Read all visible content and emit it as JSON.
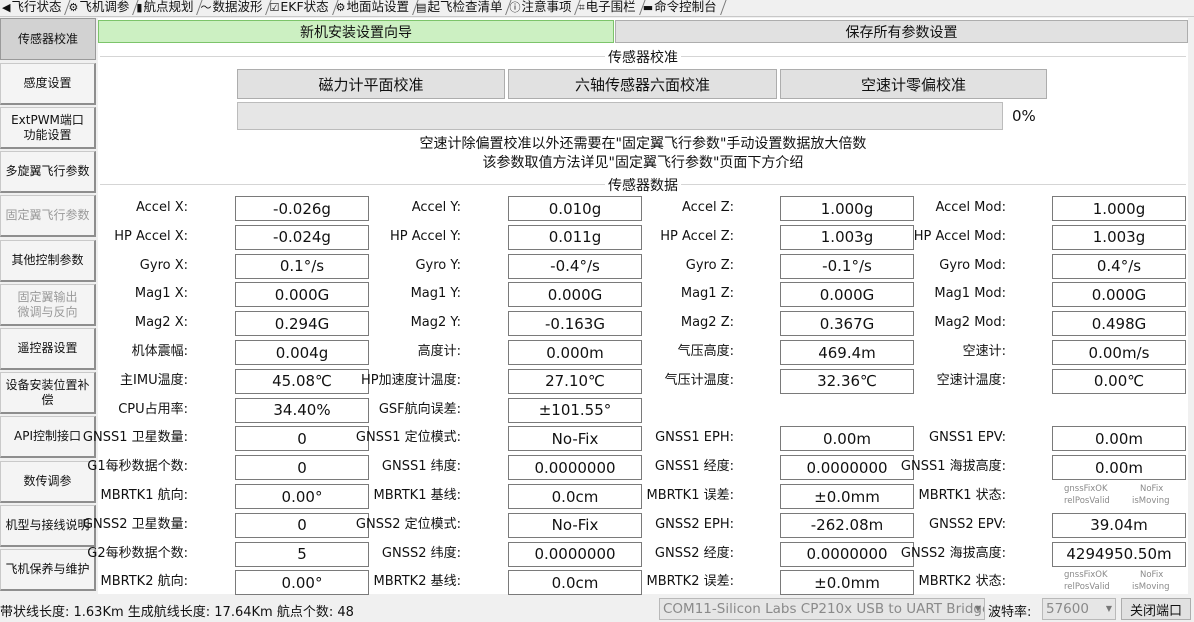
{
  "tabs": [
    {
      "icon": "◀",
      "icon_name": "arrow-icon",
      "label": "飞行状态"
    },
    {
      "icon": "⚙",
      "icon_name": "gear-icon",
      "label": "飞机调参"
    },
    {
      "icon": "▮",
      "icon_name": "book-icon",
      "label": "航点规划"
    },
    {
      "icon": "〜",
      "icon_name": "wave-chart-icon",
      "label": "数据波形"
    },
    {
      "icon": "☑",
      "icon_name": "checklist-icon",
      "label": "EKF状态"
    },
    {
      "icon": "⚙",
      "icon_name": "gear-icon",
      "label": "地面站设置"
    },
    {
      "icon": "▤",
      "icon_name": "list-icon",
      "label": "起飞检查清单"
    },
    {
      "icon": "ⓘ",
      "icon_name": "info-icon",
      "label": "注意事项"
    },
    {
      "icon": "⌗",
      "icon_name": "fence-icon",
      "label": "电子围栏"
    },
    {
      "icon": "▬",
      "icon_name": "terminal-icon",
      "label": "命令控制台"
    }
  ],
  "sidebar": [
    {
      "label": "传感器校准",
      "active": true
    },
    {
      "label": "感度设置"
    },
    {
      "label": "ExtPWM端口\n功能设置"
    },
    {
      "label": "多旋翼飞行参数"
    },
    {
      "label": "固定翼飞行参数",
      "disabled": true
    },
    {
      "label": "其他控制参数"
    },
    {
      "label": "固定翼输出\n微调与反向",
      "disabled": true
    },
    {
      "label": "遥控器设置"
    },
    {
      "label": "设备安装位置补偿"
    },
    {
      "label": "API控制接口"
    },
    {
      "label": "数传调参"
    },
    {
      "label": "机型与接线说明"
    },
    {
      "label": "飞机保养与维护"
    }
  ],
  "top_buttons": {
    "wizard": "新机安装设置向导",
    "save_all": "保存所有参数设置"
  },
  "calibration": {
    "title": "传感器校准",
    "buttons": [
      "磁力计平面校准",
      "六轴传感器六面校准",
      "空速计零偏校准"
    ],
    "progress_value": 0,
    "progress_text": "0%",
    "note_line1": "空速计除偏置校准以外还需要在\"固定翼飞行参数\"手动设置数据放大倍数",
    "note_line2": "该参数取值方法详见\"固定翼飞行参数\"页面下方介绍"
  },
  "sensor_title": "传感器数据",
  "sensor_rows": [
    [
      [
        "Accel X:",
        "-0.026g"
      ],
      [
        "Accel Y:",
        "0.010g"
      ],
      [
        "Accel Z:",
        "1.000g"
      ],
      [
        "Accel Mod:",
        "1.000g"
      ]
    ],
    [
      [
        "HP Accel X:",
        "-0.024g"
      ],
      [
        "HP Accel Y:",
        "0.011g"
      ],
      [
        "HP Accel Z:",
        "1.003g"
      ],
      [
        "HP Accel Mod:",
        "1.003g"
      ]
    ],
    [
      [
        "Gyro X:",
        "0.1°/s"
      ],
      [
        "Gyro Y:",
        "-0.4°/s"
      ],
      [
        "Gyro Z:",
        "-0.1°/s"
      ],
      [
        "Gyro Mod:",
        "0.4°/s"
      ]
    ],
    [
      [
        "Mag1 X:",
        "0.000G"
      ],
      [
        "Mag1 Y:",
        "0.000G"
      ],
      [
        "Mag1 Z:",
        "0.000G"
      ],
      [
        "Mag1 Mod:",
        "0.000G"
      ]
    ],
    [
      [
        "Mag2 X:",
        "0.294G"
      ],
      [
        "Mag2 Y:",
        "-0.163G"
      ],
      [
        "Mag2 Z:",
        "0.367G"
      ],
      [
        "Mag2 Mod:",
        "0.498G"
      ]
    ],
    [
      [
        "机体震幅:",
        "0.004g"
      ],
      [
        "高度计:",
        "0.000m"
      ],
      [
        "气压高度:",
        "469.4m"
      ],
      [
        "空速计:",
        "0.00m/s"
      ]
    ],
    [
      [
        "主IMU温度:",
        "45.08℃"
      ],
      [
        "HP加速度计温度:",
        "27.10℃"
      ],
      [
        "气压计温度:",
        "32.36℃"
      ],
      [
        "空速计温度:",
        "0.00℃"
      ]
    ],
    [
      [
        "CPU占用率:",
        "34.40%"
      ],
      [
        "GSF航向误差:",
        "±101.55°"
      ],
      null,
      null
    ],
    [
      [
        "GNSS1 卫星数量:",
        "0"
      ],
      [
        "GNSS1 定位模式:",
        "No-Fix"
      ],
      [
        "GNSS1 EPH:",
        "0.00m"
      ],
      [
        "GNSS1 EPV:",
        "0.00m"
      ]
    ],
    [
      [
        "G1每秒数据个数:",
        "0"
      ],
      [
        "GNSS1 纬度:",
        "0.0000000"
      ],
      [
        "GNSS1 经度:",
        "0.0000000"
      ],
      [
        "GNSS1 海拔高度:",
        "0.00m"
      ]
    ],
    [
      [
        "MBRTK1 航向:",
        "0.00°"
      ],
      [
        "MBRTK1 基线:",
        "0.0cm"
      ],
      [
        "MBRTK1 误差:",
        "±0.0mm"
      ],
      [
        "MBRTK1 状态:",
        "#status"
      ]
    ],
    [
      [
        "GNSS2 卫星数量:",
        "0"
      ],
      [
        "GNSS2 定位模式:",
        "No-Fix"
      ],
      [
        "GNSS2 EPH:",
        "-262.08m"
      ],
      [
        "GNSS2 EPV:",
        "39.04m"
      ]
    ],
    [
      [
        "G2每秒数据个数:",
        "5"
      ],
      [
        "GNSS2 纬度:",
        "0.0000000"
      ],
      [
        "GNSS2 经度:",
        "0.0000000"
      ],
      [
        "GNSS2 海拔高度:",
        "4294950.50m"
      ]
    ],
    [
      [
        "MBRTK2 航向:",
        "0.00°"
      ],
      [
        "MBRTK2 基线:",
        "0.0cm"
      ],
      [
        "MBRTK2 误差:",
        "±0.0mm"
      ],
      [
        "MBRTK2 状态:",
        "#status"
      ]
    ]
  ],
  "rtk_status": {
    "tl": "gnssFixOK",
    "tr": "NoFix",
    "bl": "relPosValid",
    "br": "isMoving"
  },
  "statusbar": {
    "info": "带状线长度: 1.63Km 生成航线长度: 17.64Km 航点个数: 48",
    "port": "COM11-Silicon Labs CP210x USB to UART Bridge",
    "baud_label": "波特率:",
    "baud": "57600",
    "close_label": "关闭端口"
  },
  "colors": {
    "progress_fill": "#06b025",
    "wizard_bg": "#ccf0c2"
  }
}
